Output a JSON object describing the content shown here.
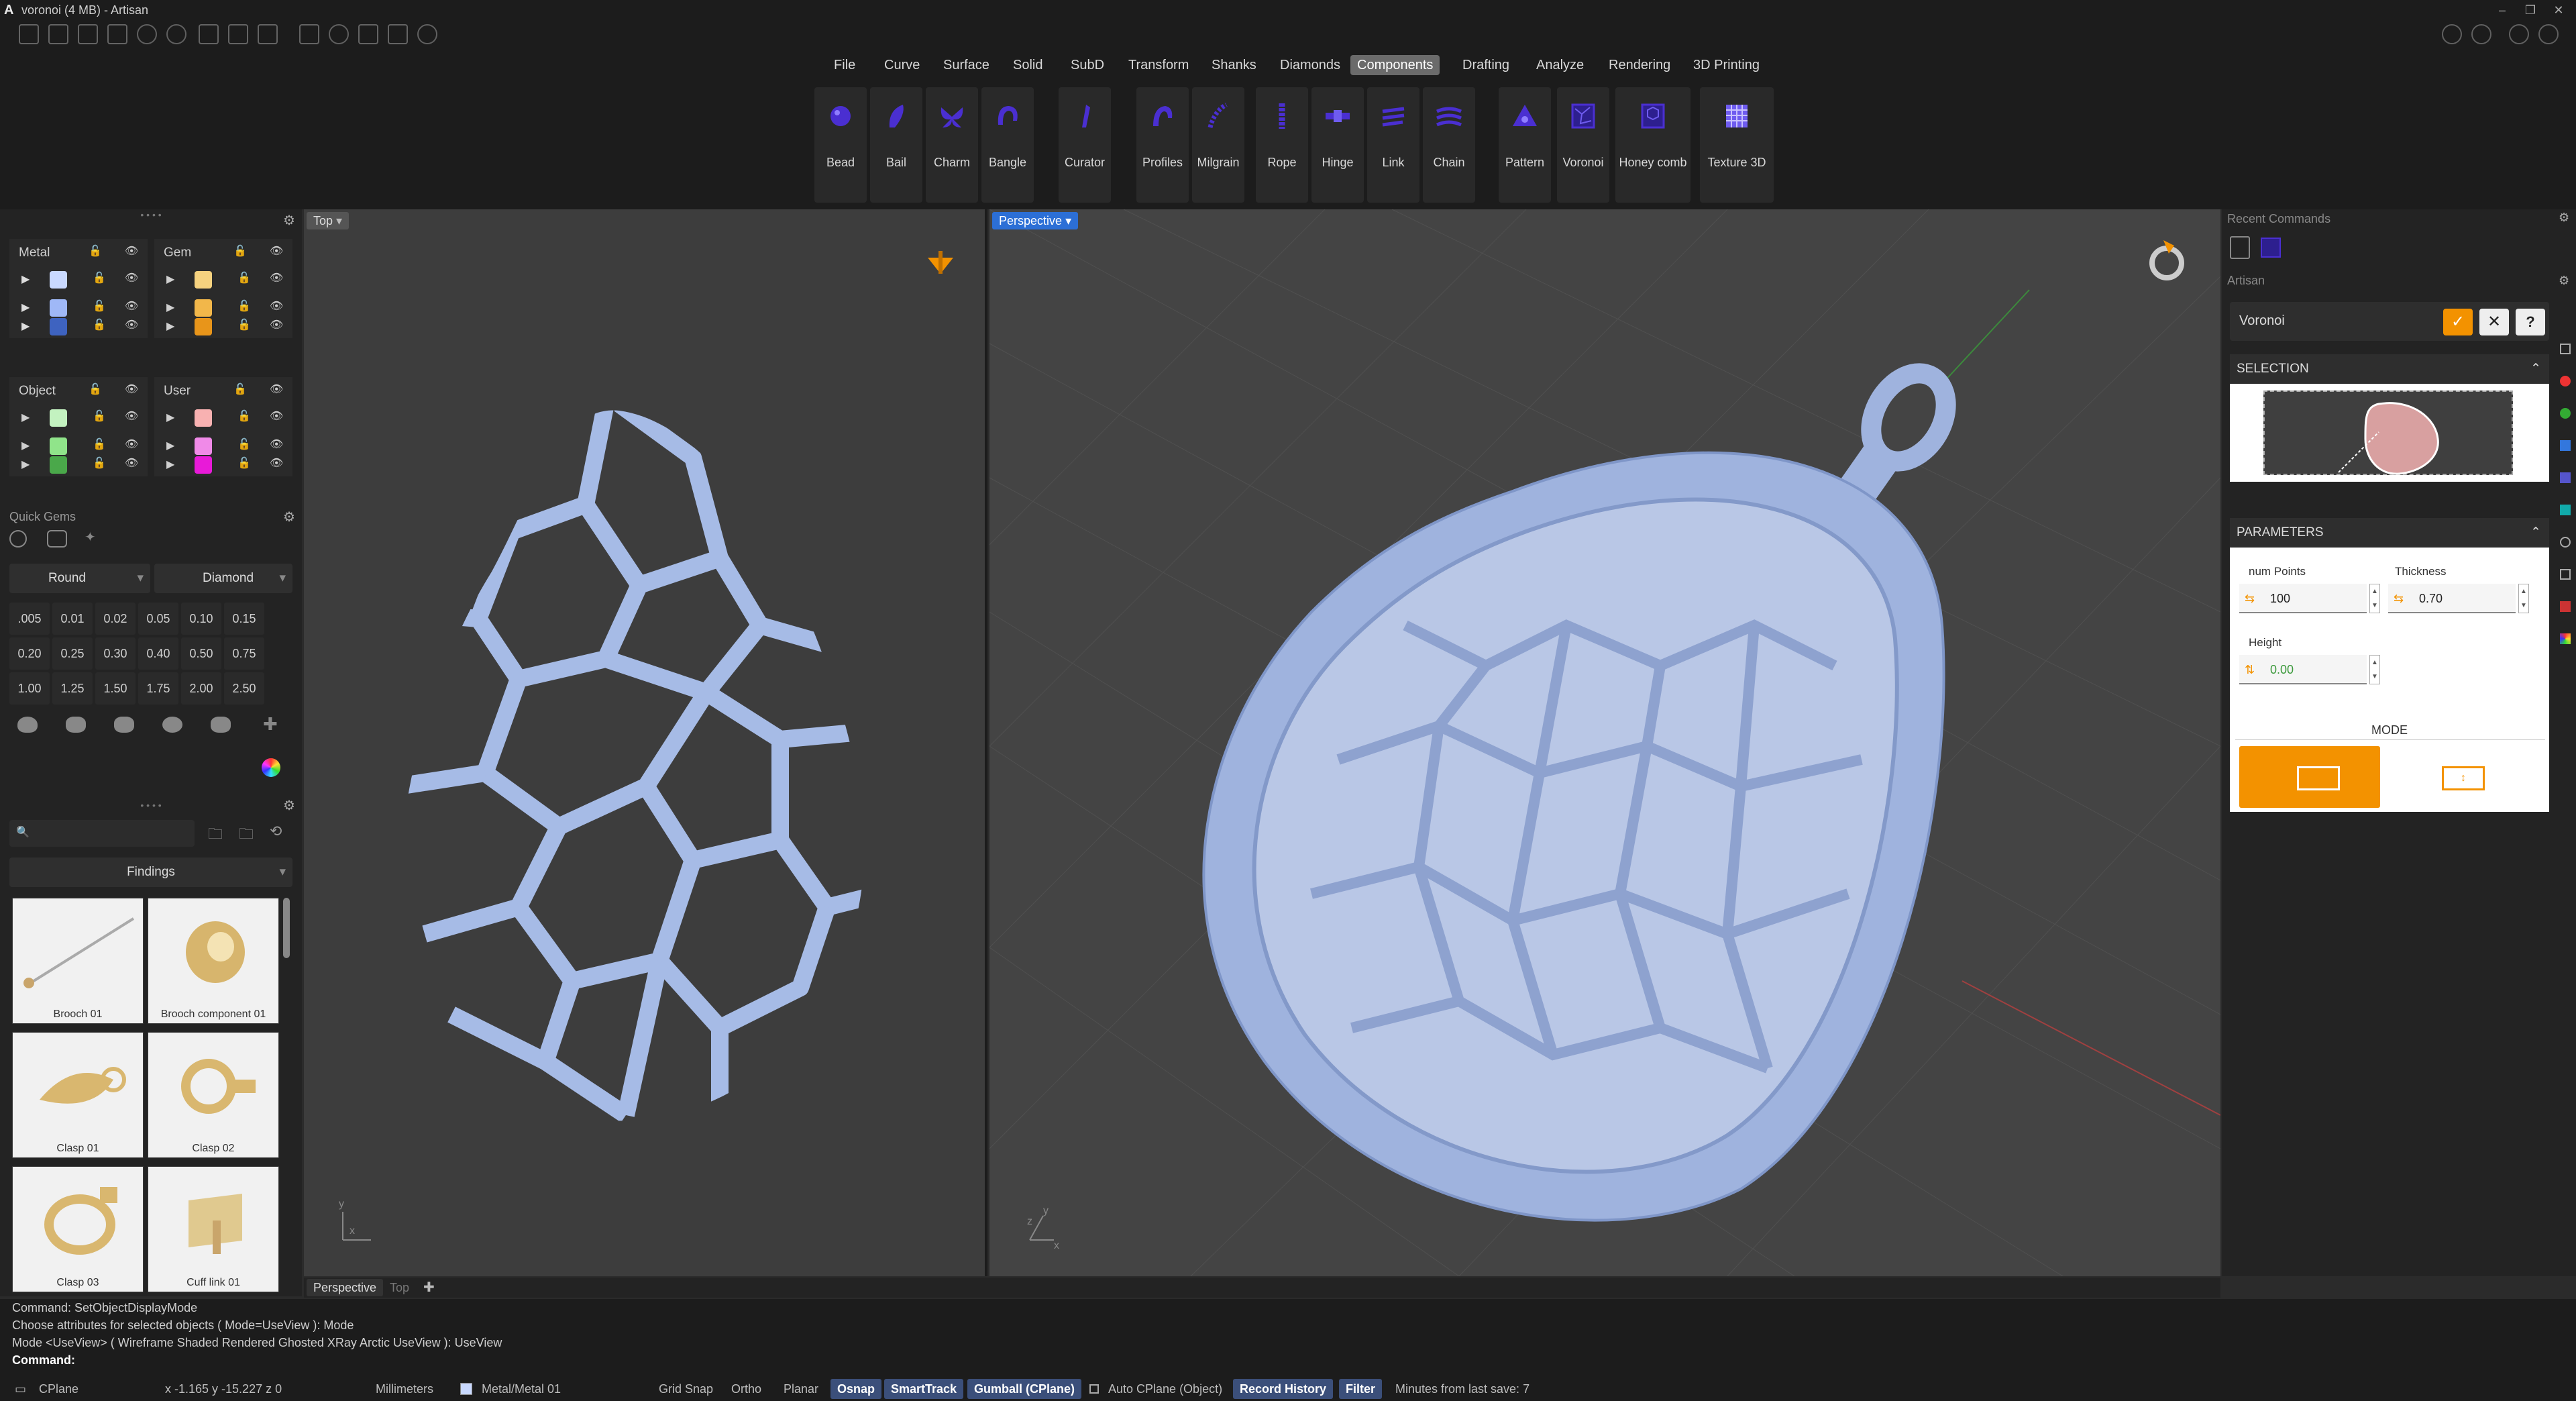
{
  "window": {
    "title": "voronoi (4 MB) - Artisan"
  },
  "menus": [
    "File",
    "Curve",
    "Surface",
    "Solid",
    "SubD",
    "Transform",
    "Shanks",
    "Diamonds",
    "Components",
    "Drafting",
    "Analyze",
    "Rendering",
    "3D Printing"
  ],
  "active_menu": "Components",
  "tools": [
    "Bead",
    "Bail",
    "Charm",
    "Bangle",
    "Curator",
    "Profiles",
    "Milgrain",
    "Rope",
    "Hinge",
    "Link",
    "Chain",
    "Pattern",
    "Voronoi",
    "Honey comb",
    "Texture 3D"
  ],
  "layers": {
    "metal": {
      "title": "Metal",
      "colors": [
        "#c9d9ff",
        "#9fb8f7",
        "#3e63c0"
      ]
    },
    "gem": {
      "title": "Gem",
      "colors": [
        "#f6d27f",
        "#f2b74a",
        "#e8951a"
      ]
    },
    "object": {
      "title": "Object",
      "colors": [
        "#c3f2c0",
        "#90e48a",
        "#4aa84a"
      ]
    },
    "user": {
      "title": "User",
      "colors": [
        "#f8b1b1",
        "#f08ae8",
        "#e81ad8"
      ]
    }
  },
  "quick_gems": {
    "title": "Quick Gems",
    "shape": "Round",
    "cut": "Diamond",
    "sizes": [
      ".005",
      "0.01",
      "0.02",
      "0.05",
      "0.10",
      "0.15",
      "0.20",
      "0.25",
      "0.30",
      "0.40",
      "0.50",
      "0.75",
      "1.00",
      "1.25",
      "1.50",
      "1.75",
      "2.00",
      "2.50"
    ]
  },
  "library": {
    "category": "Findings",
    "items": [
      "Brooch 01",
      "Brooch component 01",
      "Clasp 01",
      "Clasp 02",
      "Clasp 03",
      "Cuff link 01"
    ]
  },
  "viewports": {
    "top_label": "Top",
    "persp_label": "Perspective",
    "bottom_tabs": [
      "Perspective",
      "Top"
    ],
    "axis_x": "x",
    "axis_y": "y",
    "axis_z": "z"
  },
  "right_panel": {
    "recent_title": "Recent Commands",
    "artisan_title": "Artisan",
    "command_name": "Voronoi",
    "selection_title": "SELECTION",
    "parameters_title": "PARAMETERS",
    "params": {
      "num_points_label": "num Points",
      "num_points": "100",
      "thickness_label": "Thickness",
      "thickness": "0.70",
      "height_label": "Height",
      "height": "0.00"
    },
    "mode_title": "MODE",
    "help": "?"
  },
  "command_history": [
    "Command: SetObjectDisplayMode",
    "Choose attributes for selected objects ( Mode=UseView ): Mode",
    "Mode <UseView> ( Wireframe  Shaded  Rendered  Ghosted  XRay  Arctic  UseView ): UseView",
    "Command:"
  ],
  "status": {
    "cplane": "CPlane",
    "coords": "x -1.165   y -15.227   z 0",
    "units": "Millimeters",
    "layer": "Metal/Metal 01",
    "toggles": [
      "Grid Snap",
      "Ortho",
      "Planar",
      "Osnap",
      "SmartTrack",
      "Gumball (CPlane)",
      "Auto CPlane (Object)",
      "Record History",
      "Filter"
    ],
    "active_toggles": [
      "Osnap",
      "SmartTrack",
      "Gumball (CPlane)",
      "Record History",
      "Filter"
    ],
    "save_info": "Minutes from last save: 7"
  },
  "colors": {
    "accent": "#f39200",
    "metal": "#a6bbe6",
    "tool_icon": "#4a2fd1"
  }
}
